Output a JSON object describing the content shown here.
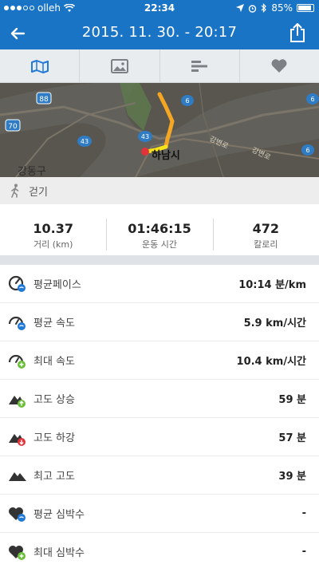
{
  "status": {
    "carrier": "olleh",
    "time": "22:34",
    "battery": "85%"
  },
  "nav": {
    "title": "2015. 11. 30. - 20:17"
  },
  "tabs": [
    {
      "name": "map-tab",
      "icon": "map-icon",
      "active": true
    },
    {
      "name": "photo-tab",
      "icon": "image-icon",
      "active": false
    },
    {
      "name": "chart-tab",
      "icon": "bar-chart-icon",
      "active": false
    },
    {
      "name": "heart-tab",
      "icon": "heart-icon",
      "active": false
    }
  ],
  "map": {
    "labels": {
      "district": "강동구",
      "city": "하남시",
      "road": "강변로"
    },
    "routes": {
      "r1": "88",
      "r2": "70",
      "r3": "43",
      "r4": "43",
      "r5": "6",
      "r6": "6",
      "r7": "6"
    }
  },
  "activity": {
    "type": "걷기"
  },
  "summary": [
    {
      "value": "10.37",
      "label": "거리 (km)"
    },
    {
      "value": "01:46:15",
      "label": "운동 시간"
    },
    {
      "value": "472",
      "label": "칼로리"
    }
  ],
  "stats": [
    {
      "label": "평균페이스",
      "value": "10:14 분/km",
      "icon": "pace-icon"
    },
    {
      "label": "평균 속도",
      "value": "5.9 km/시간",
      "icon": "speedometer-avg-icon"
    },
    {
      "label": "최대 속도",
      "value": "10.4 km/시간",
      "icon": "speedometer-max-icon"
    },
    {
      "label": "고도 상승",
      "value": "59 분",
      "icon": "mountain-up-icon"
    },
    {
      "label": "고도 하강",
      "value": "57 분",
      "icon": "mountain-down-icon"
    },
    {
      "label": "최고 고도",
      "value": "39 분",
      "icon": "mountain-icon"
    },
    {
      "label": "평균 심박수",
      "value": "-",
      "icon": "heart-avg-icon"
    },
    {
      "label": "최대 심박수",
      "value": "-",
      "icon": "heart-max-icon"
    }
  ],
  "colors": {
    "header": "#1a74c5",
    "route": "#f5a623",
    "accent_blue": "#1f7ad6",
    "accent_green": "#6cbf3b",
    "accent_red": "#e0343a"
  }
}
